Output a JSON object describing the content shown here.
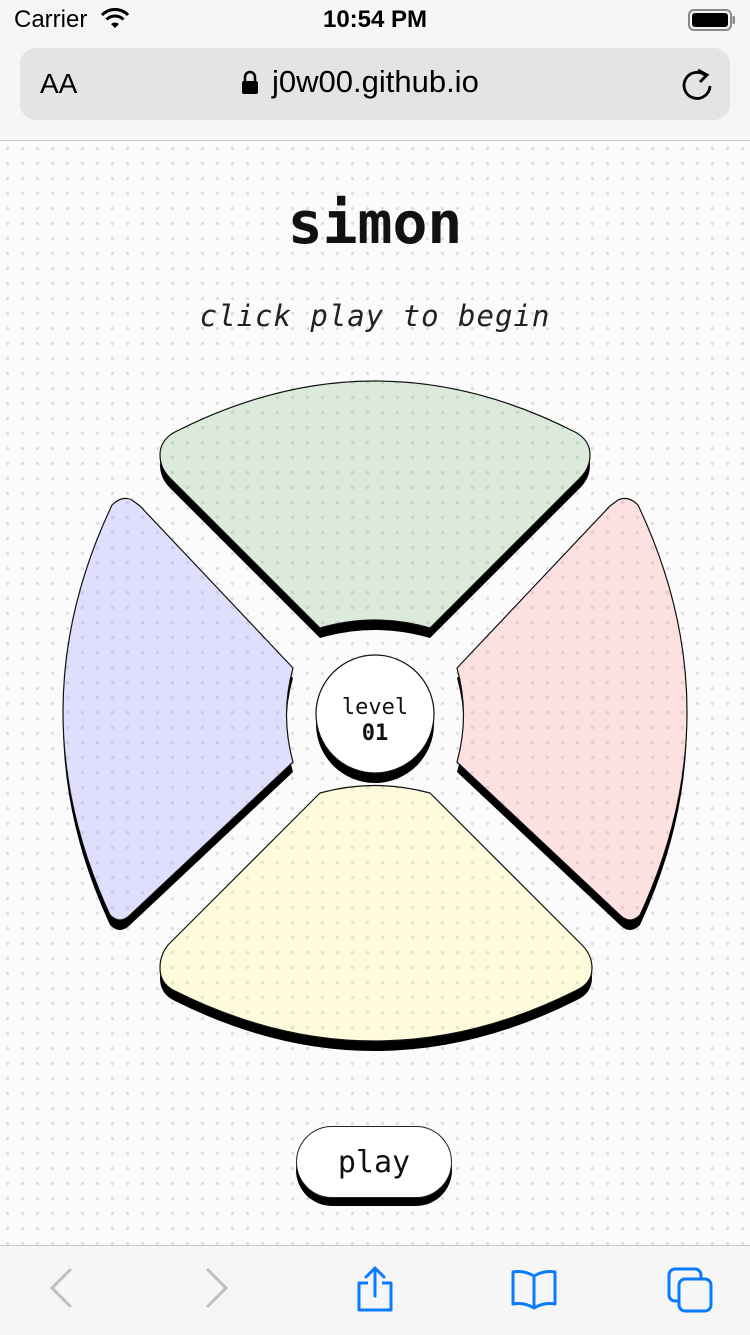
{
  "status_bar": {
    "carrier": "Carrier",
    "time": "10:54 PM"
  },
  "browser": {
    "text_size_label": "AA",
    "url": "j0w00.github.io"
  },
  "game": {
    "title": "simon",
    "status": "click play to begin",
    "level_label": "level",
    "level_value": "01",
    "play_label": "play",
    "pads": [
      {
        "name": "green",
        "color": "#dbeadb"
      },
      {
        "name": "red",
        "color": "#fde0e0"
      },
      {
        "name": "yellow",
        "color": "#fefbdc"
      },
      {
        "name": "blue",
        "color": "#dfdffd"
      }
    ]
  },
  "toolbar": {
    "items": [
      "back-icon",
      "forward-icon",
      "share-icon",
      "bookmarks-icon",
      "tabs-icon"
    ]
  }
}
